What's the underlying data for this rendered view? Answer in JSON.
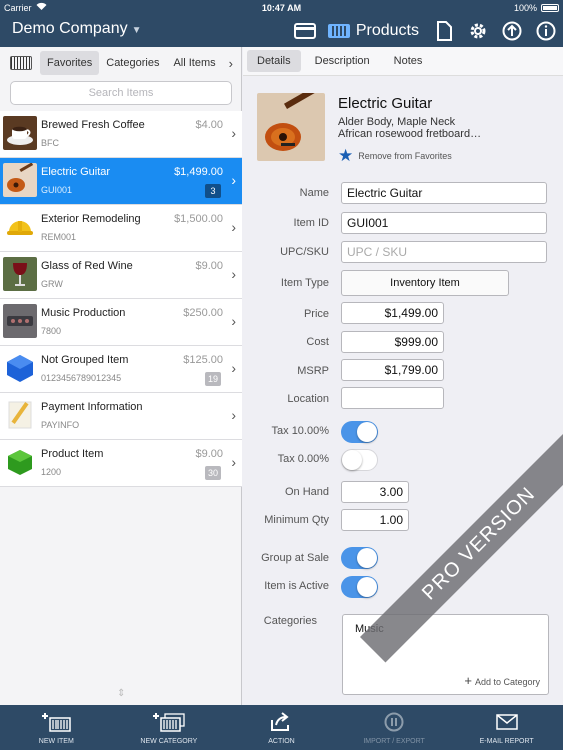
{
  "status_bar": {
    "carrier": "Carrier",
    "time": "10:47 AM",
    "battery": "100%"
  },
  "header": {
    "company": "Demo Company",
    "active_section": "Products",
    "icons": [
      "payment-icon",
      "products-icon",
      "document-icon",
      "gear-icon",
      "upload-icon",
      "info-icon"
    ]
  },
  "left_panel": {
    "tabs": [
      "Favorites",
      "Categories",
      "All Items"
    ],
    "active_tab": "Favorites",
    "search_placeholder": "Search Items",
    "items": [
      {
        "name": "Brewed Fresh Coffee",
        "code": "BFC",
        "price": "$4.00",
        "badge": ""
      },
      {
        "name": "Electric Guitar",
        "code": "GUI001",
        "price": "$1,499.00",
        "badge": "3"
      },
      {
        "name": "Exterior Remodeling",
        "code": "REM001",
        "price": "$1,500.00",
        "badge": ""
      },
      {
        "name": "Glass of Red Wine",
        "code": "GRW",
        "price": "$9.00",
        "badge": ""
      },
      {
        "name": "Music Production",
        "code": "7800",
        "price": "$250.00",
        "badge": ""
      },
      {
        "name": "Not Grouped Item",
        "code": "0123456789012345",
        "price": "$125.00",
        "badge": "19"
      },
      {
        "name": "Payment Information",
        "code": "PAYINFO",
        "price": "",
        "badge": ""
      },
      {
        "name": "Product Item",
        "code": "1200",
        "price": "$9.00",
        "badge": "30"
      }
    ]
  },
  "detail": {
    "tabs": [
      "Details",
      "Description",
      "Notes"
    ],
    "active_tab": "Details",
    "title": "Electric Guitar",
    "desc_line1": "Alder Body, Maple Neck",
    "desc_line2": "African rosewood fretboard…",
    "favorite_action": "Remove from Favorites",
    "labels": {
      "name": "Name",
      "item_id": "Item ID",
      "upc": "UPC/SKU",
      "item_type": "Item Type",
      "price": "Price",
      "cost": "Cost",
      "msrp": "MSRP",
      "location": "Location",
      "tax1": "Tax 10.00%",
      "tax2": "Tax 0.00%",
      "on_hand": "On Hand",
      "min_qty": "Minimum Qty",
      "group_at_sale": "Group at Sale",
      "item_active": "Item is Active",
      "categories": "Categories"
    },
    "values": {
      "name": "Electric Guitar",
      "item_id": "GUI001",
      "upc_placeholder": "UPC / SKU",
      "item_type": "Inventory Item",
      "price": "$1,499.00",
      "cost": "$999.00",
      "msrp": "$1,799.00",
      "location": "",
      "on_hand": "3.00",
      "min_qty": "1.00"
    },
    "toggles": {
      "tax1": true,
      "tax2": false,
      "group_at_sale": true,
      "item_active": true
    },
    "categories": [
      "Music"
    ],
    "add_category": "Add to Category",
    "ribbon": "PRO VERSION"
  },
  "toolbar": {
    "items": [
      {
        "label": "NEW ITEM",
        "icon": "new-item-icon"
      },
      {
        "label": "NEW CATEGORY",
        "icon": "new-category-icon"
      },
      {
        "label": "ACTION",
        "icon": "share-icon"
      },
      {
        "label": "IMPORT / EXPORT",
        "icon": "import-export-icon"
      },
      {
        "label": "E-MAIL REPORT",
        "icon": "mail-icon"
      }
    ]
  },
  "colors": {
    "nav_bg": "#2e4a66",
    "selection": "#1a8cf2",
    "toggle_on": "#4a94e8",
    "star": "#1a5fb4"
  }
}
